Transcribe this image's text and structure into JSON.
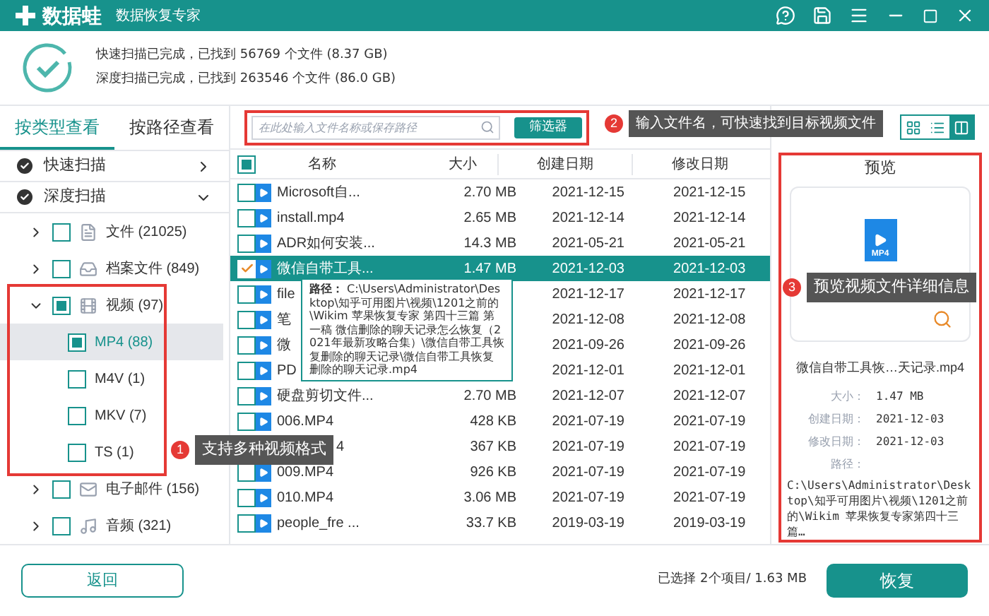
{
  "window": {
    "logo_text": "数据蛙",
    "subtitle": "数据恢复专家"
  },
  "scan_status": [
    "快速扫描已完成，已找到 56769 个文件 (8.37 GB)",
    "深度扫描已完成，已找到 263546 个文件 (86.0 GB)"
  ],
  "view_tabs": [
    {
      "label": "按类型查看",
      "selected": true
    },
    {
      "label": "按路径查看",
      "selected": false
    }
  ],
  "tree": [
    {
      "label": "快速扫描",
      "expanded": false
    },
    {
      "label": "深度扫描",
      "expanded": true,
      "children": [
        {
          "label": "文件 (21025)",
          "kind": "document",
          "checked": false,
          "expanded": false,
          "selected": false
        },
        {
          "label": "档案文件 (849)",
          "kind": "archive",
          "checked": false,
          "expanded": false,
          "selected": false
        },
        {
          "label": "视频 (97)",
          "kind": "video",
          "checked": true,
          "expanded": true,
          "selected": false,
          "children": [
            {
              "label": "MP4 (88)",
              "checked": true,
              "selected": true
            },
            {
              "label": "M4V (1)",
              "checked": false,
              "selected": false
            },
            {
              "label": "MKV (7)",
              "checked": false,
              "selected": false
            },
            {
              "label": "TS (1)",
              "checked": false,
              "selected": false
            }
          ]
        },
        {
          "label": "电子邮件 (156)",
          "kind": "email",
          "checked": false,
          "expanded": false,
          "selected": false
        },
        {
          "label": "音频 (321)",
          "kind": "audio",
          "checked": false,
          "expanded": false,
          "selected": false
        }
      ]
    }
  ],
  "search": {
    "placeholder": "在此处输入文件名称或保存路径"
  },
  "filter_button": "筛选器",
  "view_modes": [
    {
      "kind": "grid",
      "selected": false
    },
    {
      "kind": "list",
      "selected": false
    },
    {
      "kind": "preview",
      "selected": true
    }
  ],
  "table": {
    "all_checked": true,
    "columns": [
      "名称",
      "大小",
      "创建日期",
      "修改日期"
    ],
    "rows": [
      {
        "name": "Microsoft自...",
        "size": "2.70 MB",
        "created": "2021-12-15",
        "modified": "2021-12-15",
        "checked": false,
        "selected": false
      },
      {
        "name": "install.mp4",
        "size": "2.65 MB",
        "created": "2021-12-14",
        "modified": "2021-12-14",
        "checked": false,
        "selected": false
      },
      {
        "name": "ADR如何安装...",
        "size": "14.3 MB",
        "created": "2021-05-21",
        "modified": "2021-05-21",
        "checked": false,
        "selected": false
      },
      {
        "name": "微信自带工具...",
        "size": "1.47 MB",
        "created": "2021-12-03",
        "modified": "2021-12-03",
        "checked": true,
        "selected": true
      },
      {
        "name": "file",
        "created": "2021-12-17",
        "modified": "2021-12-17",
        "checked": false,
        "selected": false
      },
      {
        "name": "笔",
        "created": "2021-12-08",
        "modified": "2021-12-08",
        "checked": false,
        "selected": false
      },
      {
        "name": "微",
        "created": "2021-09-26",
        "modified": "2021-09-26",
        "checked": false,
        "selected": false
      },
      {
        "name": "PD",
        "created": "2021-12-01",
        "modified": "2021-12-01",
        "checked": false,
        "selected": false
      },
      {
        "name": "硬盘剪切文件...",
        "size": "2.70 MB",
        "created": "2021-12-07",
        "modified": "2021-12-07",
        "checked": false,
        "selected": false
      },
      {
        "name": "006.MP4",
        "size": "428 KB",
        "created": "2021-07-19",
        "modified": "2021-07-19",
        "checked": false,
        "selected": false
      },
      {
        "name": "4",
        "size": "367 KB",
        "created": "2021-07-19",
        "modified": "2021-07-19",
        "selected": false
      },
      {
        "name": "009.MP4",
        "size": "926 KB",
        "created": "2021-07-19",
        "modified": "2021-07-19",
        "checked": false,
        "selected": false
      },
      {
        "name": "010.MP4",
        "size": "3.06 MB",
        "created": "2021-07-19",
        "modified": "2021-07-19",
        "checked": false,
        "selected": false
      },
      {
        "name": "people_fre ...",
        "size": "33.7 KB",
        "created": "2019-03-19",
        "modified": "2019-03-19",
        "checked": false,
        "selected": false
      }
    ]
  },
  "path_tooltip": "**路径：** C:\\Users\\Administrator\\Desktop\\知乎可用图片\\视频\\1201之前的\\Wikim 苹果恢复专家 第四十三篇 第一稿 微信删除的聊天记录怎么恢复（2021年最新攻略合集）\\微信自带工具恢复删除的聊天记录\\微信自带工具恢复删除的聊天记录.mp4",
  "preview": {
    "title": "预览",
    "file_badge": "MP4",
    "file_name": "微信自带工具恢…天记录.mp4",
    "details": [
      {
        "label": "大小：",
        "value": "1.47 MB"
      },
      {
        "label": "创建日期：",
        "value": "2021-12-03"
      },
      {
        "label": "修改日期：",
        "value": "2021-12-03"
      }
    ],
    "path_label": "路径：",
    "path": "C:\\Users\\Administrator\\Desktop\\知乎可用图片\\视频\\1201之前的\\Wikim 苹果恢复专家第四十三篇…"
  },
  "callouts": [
    {
      "number": "1",
      "text": "支持多种视频格式"
    },
    {
      "number": "2",
      "text": "输入文件名，可快速找到目标视频文件"
    },
    {
      "number": "3",
      "text": "预览视频文件详细信息"
    }
  ],
  "footer": {
    "back_button": "返回",
    "selection": "已选择 2个项目/ 1.63 MB",
    "recover_button": "恢复"
  }
}
